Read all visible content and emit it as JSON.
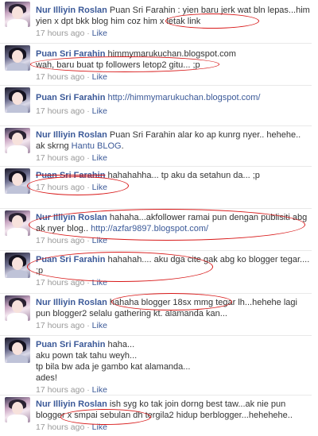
{
  "like_label": "Like",
  "dot": "·",
  "posts": [
    {
      "author": "Nur Illiyin Roslan",
      "text": "Puan Sri Farahin : yien baru jerk wat bln lepas...him yien x dpt bkk blog him coz him x letak link",
      "time": "17 hours ago"
    },
    {
      "author": "Puan Sri Farahin",
      "link": "himmymarukuchan.blogspot.com",
      "text": "wah, baru buat tp followers letop2 gitu... ;p",
      "time": "17 hours ago"
    },
    {
      "author": "Puan Sri Farahin",
      "link": "http://himmymarukuchan.blogspot.com/",
      "time": "17 hours ago"
    },
    {
      "author": "Nur Illiyin Roslan",
      "text_before": "Puan Sri Farahin alar ko ap kunrg nyer.. hehehe.. ak skrng",
      "link": "Hantu BLOG",
      "text_after": ".",
      "time": "17 hours ago"
    },
    {
      "author": "Puan Sri Farahin",
      "text": "hahahahha... tp aku da setahun da... ;p",
      "time": "17 hours ago"
    },
    {
      "author": "Nur Illiyin Roslan",
      "text": "hahaha...akfollower ramai pun dengan publisiti abg ak nyer blog..",
      "link": "http://azfar9897.blogspot.com/",
      "time": "17 hours ago"
    },
    {
      "author": "Puan Sri Farahin",
      "text": "hahahah.... aku dga cite gak abg ko blogger tegar.... ;p",
      "time": "17 hours ago"
    },
    {
      "author": "Nur Illiyin Roslan",
      "text": "hahaha blogger 18sx mmg tegar lh...hehehe lagi pun blogger2 selalu gathering kt. alamanda kan...",
      "time": "17 hours ago"
    },
    {
      "author": "Puan Sri Farahin",
      "lines": [
        "haha...",
        "aku pown tak tahu weyh...",
        "tp bila bw ada je gambo kat alamanda...",
        "ades!"
      ],
      "time": "17 hours ago"
    },
    {
      "author": "Nur Illiyin Roslan",
      "text": "ish syg ko tak join dorng best taw...ak nie pun blogger x smpai sebulan dh tergila2 hidup berblogger...hehehehe..",
      "time": "17 hours ago"
    }
  ]
}
